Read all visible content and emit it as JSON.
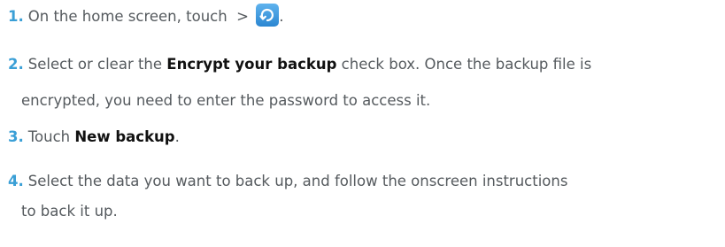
{
  "steps": [
    {
      "number": "1.",
      "text_before": "On the home screen, touch  > ",
      "icon": "backup-app-icon",
      "text_after": "."
    },
    {
      "number": "2.",
      "text_before": "Select or clear the ",
      "bold": "Encrypt your backup",
      "text_after": " check box. Once the backup file is",
      "continuation": "encrypted, you need to enter the password to access it."
    },
    {
      "number": "3.",
      "text_before": "Touch ",
      "bold": "New backup",
      "text_after": "."
    },
    {
      "number": "4.",
      "text_before": "Select the data you want to back up, and follow the onscreen instructions",
      "continuation": "to back it up."
    }
  ],
  "colors": {
    "step_number": "#3a9fd6",
    "body_text": "#555a5e",
    "bold_text": "#111111",
    "icon_background": "#3d97de"
  }
}
